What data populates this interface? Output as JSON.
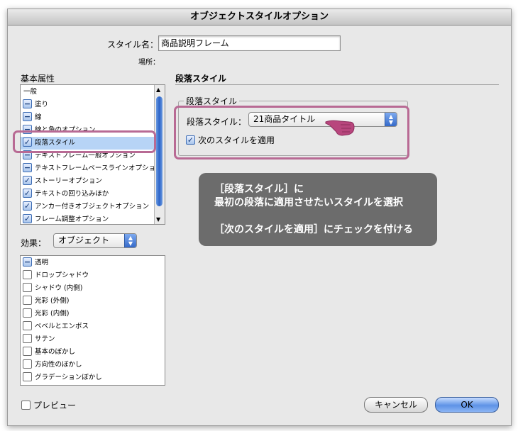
{
  "window": {
    "title": "オブジェクトスタイルオプション"
  },
  "style_name": {
    "label": "スタイル名：",
    "value": "商品説明フレーム",
    "location_label": "場所："
  },
  "basic_attributes": {
    "heading": "基本属性",
    "items": [
      {
        "label": "一般",
        "state": "none"
      },
      {
        "label": "塗り",
        "state": "dash"
      },
      {
        "label": "線",
        "state": "dash"
      },
      {
        "label": "線と角のオプション",
        "state": "dash"
      },
      {
        "label": "段落スタイル",
        "state": "checked",
        "selected": true
      },
      {
        "label": "テキストフレーム一般オプション",
        "state": "dash"
      },
      {
        "label": "テキストフレームベースラインオプション",
        "state": "dash"
      },
      {
        "label": "ストーリーオプション",
        "state": "checked"
      },
      {
        "label": "テキストの回り込みほか",
        "state": "checked"
      },
      {
        "label": "アンカー付きオブジェクトオプション",
        "state": "checked"
      },
      {
        "label": "フレーム調整オプション",
        "state": "checked"
      }
    ]
  },
  "effects": {
    "label": "効果：",
    "target": "オブジェクト",
    "items": [
      {
        "label": "透明",
        "state": "dash"
      },
      {
        "label": "ドロップシャドウ",
        "state": "unchecked"
      },
      {
        "label": "シャドウ (内側)",
        "state": "unchecked"
      },
      {
        "label": "光彩 (外側)",
        "state": "unchecked"
      },
      {
        "label": "光彩 (内側)",
        "state": "unchecked"
      },
      {
        "label": "ベベルとエンボス",
        "state": "unchecked"
      },
      {
        "label": "サテン",
        "state": "unchecked"
      },
      {
        "label": "基本のぼかし",
        "state": "unchecked"
      },
      {
        "label": "方向性のぼかし",
        "state": "unchecked"
      },
      {
        "label": "グラデーションぼかし",
        "state": "unchecked"
      }
    ]
  },
  "panel": {
    "heading": "段落スタイル",
    "group_title": "段落スタイル",
    "style_label": "段落スタイル：",
    "style_value": "21商品タイトル",
    "apply_next_label": "次のスタイルを適用",
    "apply_next_checked": true
  },
  "annotation": {
    "line1": "［段落スタイル］に",
    "line2": "最初の段落に適用させたいスタイルを選択",
    "line3": "［次のスタイルを適用］にチェックを付ける"
  },
  "footer": {
    "preview_label": "プレビュー",
    "cancel_label": "キャンセル",
    "ok_label": "OK"
  },
  "colors": {
    "highlight": "#b86a94",
    "selection": "#b7d4f6",
    "accent": "#3469c9"
  }
}
